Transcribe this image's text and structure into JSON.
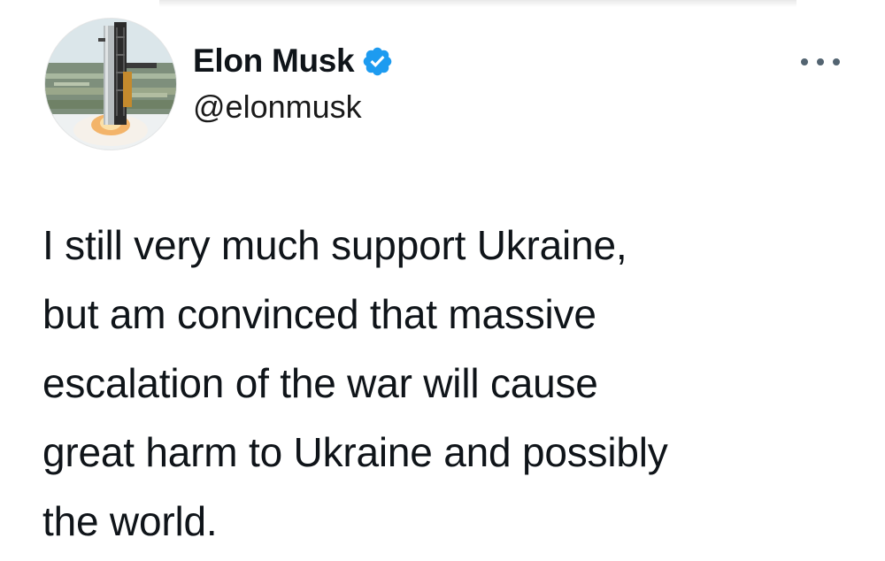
{
  "tweet": {
    "author": {
      "display_name": "Elon Musk",
      "handle": "@elonmusk",
      "verified": true
    },
    "text_lines": [
      "I still very much support Ukraine,",
      "but am convinced that massive",
      "escalation of the war will cause",
      "great harm to Ukraine and possibly",
      "the world."
    ]
  },
  "colors": {
    "verified_badge": "#1d9bf0",
    "text": "#0f1419",
    "more_dots": "#536471"
  },
  "icons": {
    "verified": "verified-badge-icon",
    "more": "more-options-icon"
  }
}
